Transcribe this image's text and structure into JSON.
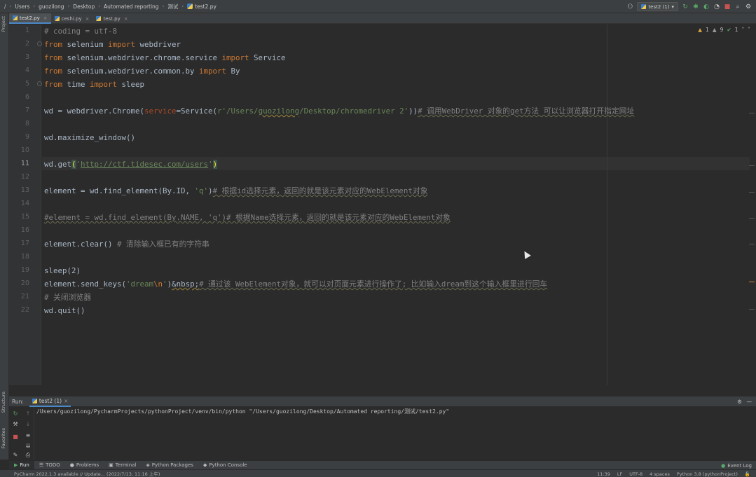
{
  "breadcrumb": [
    "/",
    "Users",
    "guozilong",
    "Desktop",
    "Automated reporting",
    "测试",
    "test2.py"
  ],
  "run_config": {
    "label": "test2 (1)"
  },
  "sidebar": {
    "project_label": "Project",
    "structure_label": "Structure",
    "favorites_label": "Favorites"
  },
  "tabs": [
    {
      "label": "test2.py",
      "active": true
    },
    {
      "label": "ceshi.py",
      "active": false
    },
    {
      "label": "test.py",
      "active": false
    }
  ],
  "inspections": {
    "warnings": "1",
    "weak_warnings": "9",
    "typos": "1"
  },
  "editor": {
    "current_line": 11,
    "line_numbers": [
      "1",
      "2",
      "3",
      "4",
      "5",
      "6",
      "7",
      "8",
      "9",
      "10",
      "11",
      "12",
      "13",
      "14",
      "15",
      "16",
      "17",
      "18",
      "19",
      "20",
      "21",
      "22"
    ],
    "lines": {
      "l1": "# coding = utf-8",
      "l2_a": "from",
      "l2_b": " selenium ",
      "l2_c": "import",
      "l2_d": " webdriver",
      "l3_a": "from",
      "l3_b": " selenium.webdriver.chrome.service ",
      "l3_c": "import",
      "l3_d": " Service",
      "l4_a": "from",
      "l4_b": " selenium.webdriver.common.by ",
      "l4_c": "import",
      "l4_d": " By",
      "l5_a": "from",
      "l5_b": " time ",
      "l5_c": "import",
      "l5_d": " sleep",
      "l7_a": "wd = webdriver.Chrome(",
      "l7_b": "service",
      "l7_c": "=Service(",
      "l7_d": "r'/Users/",
      "l7_e": "guozilong",
      "l7_f": "/Desktop/chromedriver 2'",
      "l7_g": "))",
      "l7_h": "# 调用WebDriver 对象的get方法 可以让浏览器打开指定网址",
      "l9": "wd.maximize_window()",
      "l11_a": "wd.get",
      "l11_b": "(",
      "l11_c": "'",
      "l11_d": "http://ctf.tidesec.com/users",
      "l11_e": "'",
      "l11_f": ")",
      "l13_a": "element = wd.find_element(By.ID, ",
      "l13_b": "'q'",
      "l13_c": ")",
      "l13_d": "# 根据id选择元素，返回的就是该元素对应的WebElement对象",
      "l15": "#element = wd.find_element(By.NAME, 'q')# 根据Name选择元素，返回的就是该元素对应的WebElement对象",
      "l17_a": "element.clear()",
      "l17_b": " # 清除输入框已有的字符串",
      "l19": "sleep(2)",
      "l20_a": "element.send_keys(",
      "l20_b": "'dream",
      "l20_c": "\\n",
      "l20_d": "'",
      "l20_e": ")",
      "l20_f": "&nbsp;",
      "l20_g": "# 通过该 WebElement对象，就可以对页面元素进行操作了; 比如输入dream到这个输入框里进行回车",
      "l21": "# 关闭浏览器",
      "l22": "wd.quit()"
    }
  },
  "run_panel": {
    "label": "Run:",
    "tab": "test2 (1)",
    "output": "/Users/guozilong/PycharmProjects/pythonProject/venv/bin/python \"/Users/guozilong/Desktop/Automated reporting/测试/test2.py\""
  },
  "bottom_tools": [
    "Run",
    "TODO",
    "Problems",
    "Terminal",
    "Python Packages",
    "Python Console"
  ],
  "event_log": "Event Log",
  "status": {
    "message": "PyCharm 2022.1.3 available // Update... (2022/7/13, 11:16 上午)",
    "position": "11:39",
    "line_sep": "LF",
    "encoding": "UTF-8",
    "indent": "4 spaces",
    "interpreter": "Python 3.8 (pythonProject)"
  },
  "colors": {
    "background": "#2b2b2b",
    "keyword": "#cc7832",
    "string": "#6a8759",
    "comment": "#808080",
    "accent": "#4a88c7"
  }
}
